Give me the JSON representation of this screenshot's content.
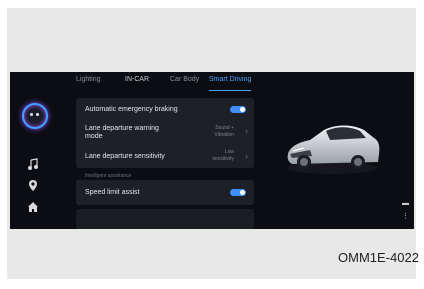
{
  "tabs": [
    {
      "label": "Lighting",
      "active": false
    },
    {
      "label": "IN-CAR",
      "active": false
    },
    {
      "label": "Car Body",
      "active": false
    },
    {
      "label": "Smart Driving",
      "active": true
    }
  ],
  "settings": {
    "aeb": {
      "label": "Automatic emergency braking",
      "enabled": true
    },
    "ldw_mode": {
      "label_line1": "Lane departure warning",
      "label_line2": "mode",
      "value_line1": "Sound +",
      "value_line2": "Vibration"
    },
    "ld_sensitivity": {
      "label": "Lane departure sensitivity",
      "value_line1": "Low",
      "value_line2": "sensitivity"
    },
    "section_label": "Intelligent assistance",
    "speed_limit": {
      "label": "Speed limit assist",
      "enabled": true
    }
  },
  "leftbar_icons": [
    "assistant-avatar-icon",
    "music-icon",
    "location-icon",
    "home-icon"
  ],
  "caption": "OMM1E-4022",
  "colors": {
    "accent": "#4aa3ff",
    "toggle_on": "#3f8fff",
    "panel": "#1d2027",
    "screen_bg": "#0b0d12"
  }
}
